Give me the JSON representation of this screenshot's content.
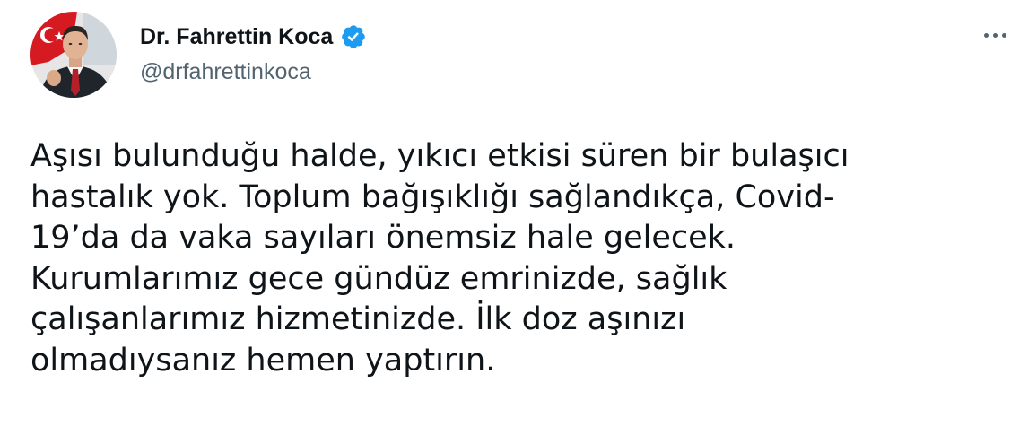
{
  "author": {
    "display_name": "Dr. Fahrettin Koca",
    "handle": "@drfahrettinkoca",
    "verified": true,
    "verified_icon": "verified-badge-icon",
    "avatar_icon": "profile-photo-avatar"
  },
  "menu": {
    "icon": "more-options-icon"
  },
  "tweet": {
    "lines": [
      "Aşısı bulunduğu halde, yıkıcı etkisi süren bir bulaşıcı",
      "hastalık yok. Toplum bağışıklığı sağlandıkça, Covid-",
      "19’da da vaka sayıları önemsiz hale gelecek.",
      "Kurumlarımız gece gündüz emrinizde, sağlık",
      "çalışanlarımız hizmetinizde. İlk doz aşınızı",
      "olmadıysanız hemen yaptırın."
    ]
  },
  "colors": {
    "text": "#0f1419",
    "secondary": "#536471",
    "verified": "#1d9bf0"
  }
}
